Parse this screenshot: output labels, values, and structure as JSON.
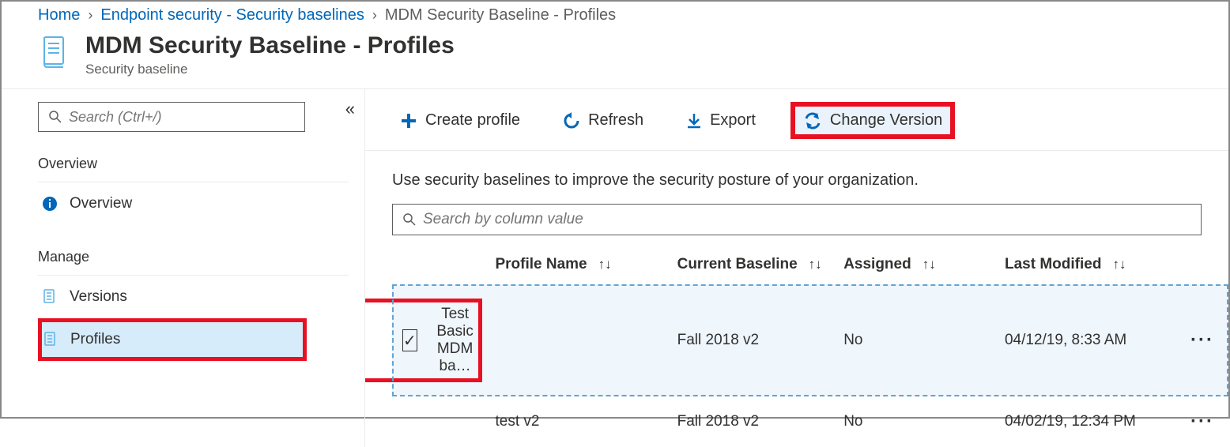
{
  "breadcrumb": {
    "home": "Home",
    "endpoint": "Endpoint security - Security baselines",
    "current": "MDM Security Baseline - Profiles"
  },
  "header": {
    "title": "MDM Security Baseline - Profiles",
    "subtitle": "Security baseline"
  },
  "sidebar": {
    "search_placeholder": "Search (Ctrl+/)",
    "section_overview": "Overview",
    "item_overview": "Overview",
    "section_manage": "Manage",
    "item_versions": "Versions",
    "item_profiles": "Profiles"
  },
  "toolbar": {
    "create": "Create profile",
    "refresh": "Refresh",
    "export": "Export",
    "change_version": "Change Version"
  },
  "main": {
    "description": "Use security baselines to improve the security posture of your organization.",
    "table_search_placeholder": "Search by column value"
  },
  "table": {
    "headers": {
      "name": "Profile Name",
      "baseline": "Current Baseline",
      "assigned": "Assigned",
      "modified": "Last Modified"
    },
    "rows": [
      {
        "name": "Test Basic MDM ba…",
        "baseline": "Fall 2018 v2",
        "assigned": "No",
        "modified": "04/12/19, 8:33 AM",
        "selected": true
      },
      {
        "name": "test v2",
        "baseline": "Fall 2018 v2",
        "assigned": "No",
        "modified": "04/02/19, 12:34 PM",
        "selected": false
      }
    ]
  }
}
